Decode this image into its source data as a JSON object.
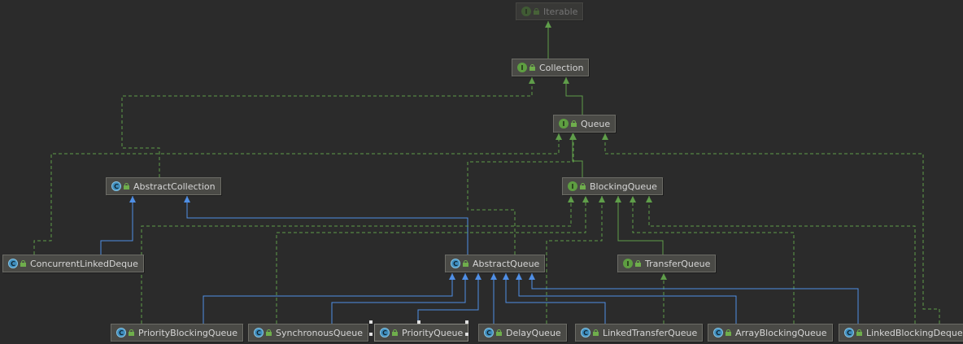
{
  "nodes": {
    "iterable": {
      "label": "Iterable",
      "kind": "I"
    },
    "collection": {
      "label": "Collection",
      "kind": "I"
    },
    "queue": {
      "label": "Queue",
      "kind": "I"
    },
    "abstract_collection": {
      "label": "AbstractCollection",
      "kind": "C"
    },
    "blocking_queue": {
      "label": "BlockingQueue",
      "kind": "I"
    },
    "concurrent_linked_deque": {
      "label": "ConcurrentLinkedDeque",
      "kind": "C"
    },
    "abstract_queue": {
      "label": "AbstractQueue",
      "kind": "C"
    },
    "transfer_queue": {
      "label": "TransferQueue",
      "kind": "I"
    },
    "priority_blocking_queue": {
      "label": "PriorityBlockingQueue",
      "kind": "C"
    },
    "synchronous_queue": {
      "label": "SynchronousQueue",
      "kind": "C"
    },
    "priority_queue": {
      "label": "PriorityQueue",
      "kind": "C"
    },
    "delay_queue": {
      "label": "DelayQueue",
      "kind": "C"
    },
    "linked_transfer_queue": {
      "label": "LinkedTransferQueue",
      "kind": "C"
    },
    "array_blocking_queue": {
      "label": "ArrayBlockingQueue",
      "kind": "C"
    },
    "linked_blocking_deque": {
      "label": "LinkedBlockingDeque",
      "kind": "C"
    }
  },
  "colors": {
    "extends_interface": "#5f9e4a",
    "extends_class": "#4f8fe6",
    "implements": "#5f9e4a"
  }
}
